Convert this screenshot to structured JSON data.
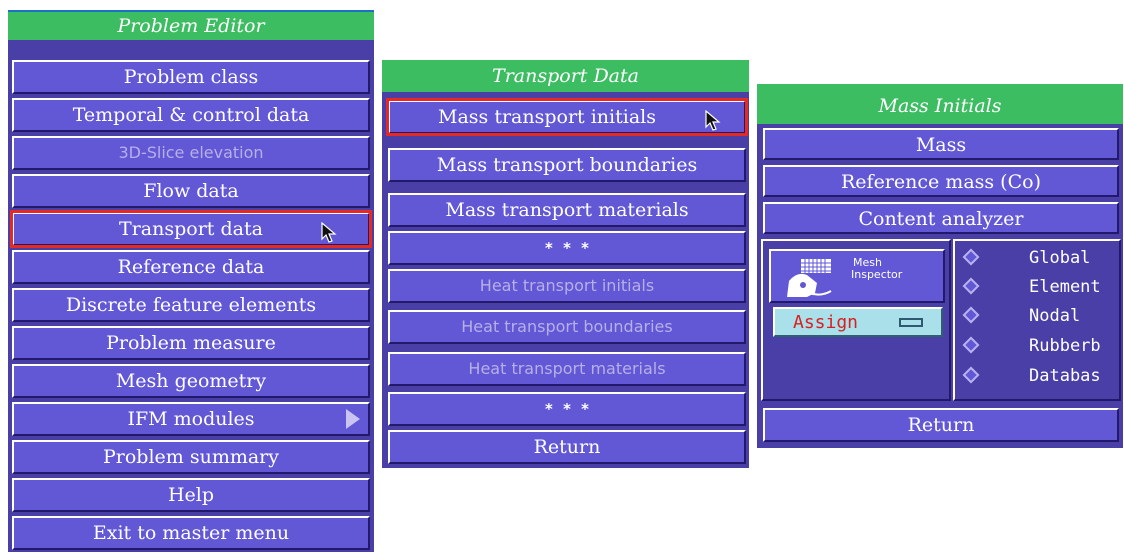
{
  "problem_editor": {
    "title": "Problem Editor",
    "items": [
      {
        "label": "Problem class"
      },
      {
        "label": "Temporal & control data"
      },
      {
        "label": "3D-Slice elevation"
      },
      {
        "label": "Flow data"
      },
      {
        "label": "Transport data"
      },
      {
        "label": "Reference data"
      },
      {
        "label": "Discrete feature elements"
      },
      {
        "label": "Problem measure"
      },
      {
        "label": "Mesh geometry"
      },
      {
        "label": "IFM modules"
      },
      {
        "label": "Problem summary"
      },
      {
        "label": "Help"
      },
      {
        "label": "Exit to master menu"
      }
    ]
  },
  "transport_data": {
    "title": "Transport Data",
    "items": [
      {
        "label": "Mass transport initials"
      },
      {
        "label": "Mass transport boundaries"
      },
      {
        "label": "Mass transport materials"
      },
      {
        "label": "* * *"
      },
      {
        "label": "Heat transport initials"
      },
      {
        "label": "Heat transport boundaries"
      },
      {
        "label": "Heat transport materials"
      },
      {
        "label": "* * *"
      },
      {
        "label": "Return"
      }
    ]
  },
  "mass_initials": {
    "title": "Mass Initials",
    "items": [
      {
        "label": "Mass"
      },
      {
        "label": "Reference mass (Co)"
      },
      {
        "label": "Content analyzer"
      }
    ],
    "mesh_inspector": {
      "line1": "Mesh",
      "line2": "Inspector"
    },
    "assign_label": "Assign",
    "scope_options": [
      {
        "label": "Global"
      },
      {
        "label": "Element"
      },
      {
        "label": "Nodal"
      },
      {
        "label": "Rubberb"
      },
      {
        "label": "Databas"
      }
    ],
    "return_label": "Return"
  },
  "colors": {
    "title_bar": "#3dbd62",
    "button": "#6257d4",
    "panel": "#4a3fa6",
    "selection": "#e52a25"
  }
}
